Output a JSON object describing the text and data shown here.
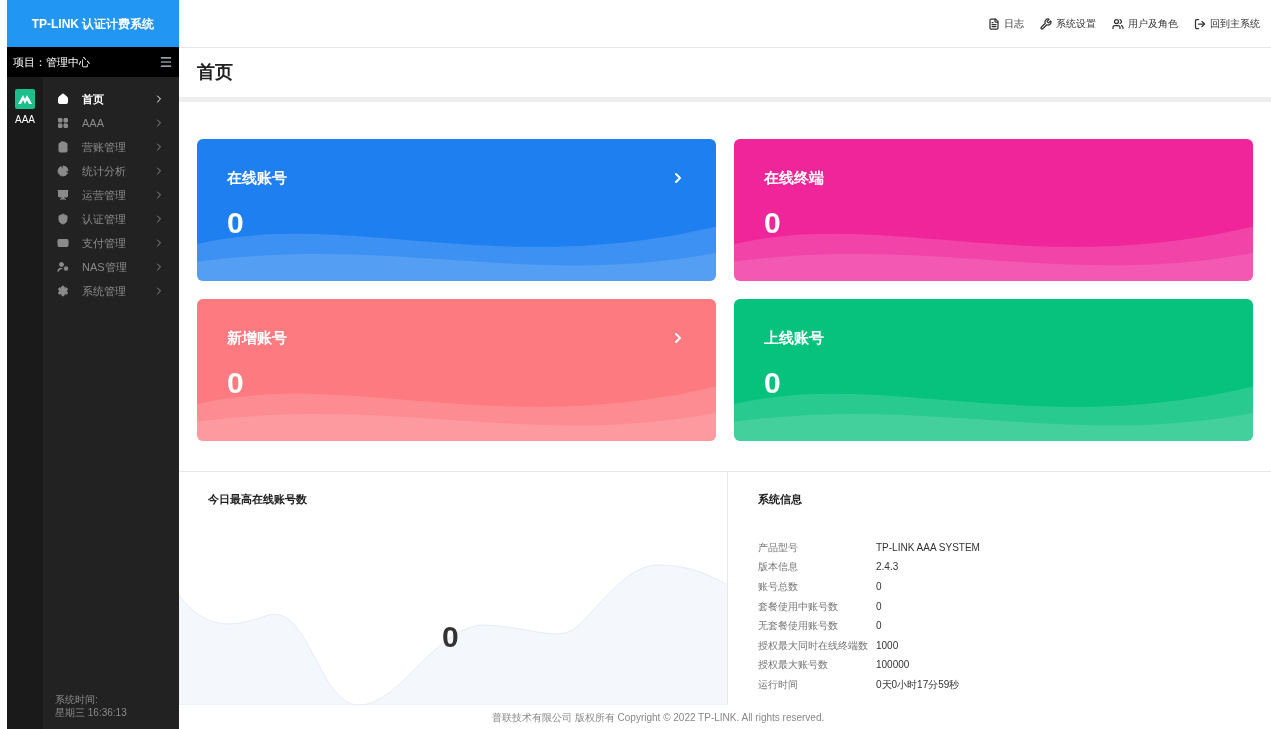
{
  "sidebar": {
    "brand": "TP-LINK 认证计费系统",
    "project": "项目：管理中心",
    "app_label": "AAA",
    "items": [
      {
        "label": "首页",
        "selected": true
      },
      {
        "label": "AAA",
        "selected": false
      },
      {
        "label": "营账管理",
        "selected": false
      },
      {
        "label": "统计分析",
        "selected": false
      },
      {
        "label": "运营管理",
        "selected": false
      },
      {
        "label": "认证管理",
        "selected": false
      },
      {
        "label": "支付管理",
        "selected": false
      },
      {
        "label": "NAS管理",
        "selected": false
      },
      {
        "label": "系统管理",
        "selected": false
      }
    ],
    "time_label": "系统时间:",
    "time": "星期三 16:36:13"
  },
  "top_links": [
    "日志",
    "系统设置",
    "用户及角色",
    "回到主系统"
  ],
  "page_title": "首页",
  "cards": [
    {
      "title": "在线账号",
      "value": "0",
      "arrow": true,
      "color": "#1e7ff0"
    },
    {
      "title": "在线终端",
      "value": "0",
      "arrow": false,
      "color": "#f0259a"
    },
    {
      "title": "新增账号",
      "value": "0",
      "arrow": true,
      "color": "#fd7a80"
    },
    {
      "title": "上线账号",
      "value": "0",
      "arrow": false,
      "color": "#06c27d"
    }
  ],
  "peak_panel": {
    "title": "今日最高在线账号数",
    "value": "0"
  },
  "system_info": {
    "title": "系统信息",
    "rows": [
      {
        "label": "产品型号",
        "value": "TP-LINK AAA SYSTEM"
      },
      {
        "label": "版本信息",
        "value": "2.4.3"
      },
      {
        "label": "账号总数",
        "value": "0"
      },
      {
        "label": "套餐使用中账号数",
        "value": "0"
      },
      {
        "label": "无套餐使用账号数",
        "value": "0"
      },
      {
        "label": "授权最大同时在线终端数",
        "value": "1000"
      },
      {
        "label": "授权最大账号数",
        "value": "100000"
      },
      {
        "label": "运行时间",
        "value": "0天0小时17分59秒"
      }
    ]
  },
  "footer": "普联技术有限公司 版权所有 Copyright © 2022 TP-LINK. All rights reserved."
}
